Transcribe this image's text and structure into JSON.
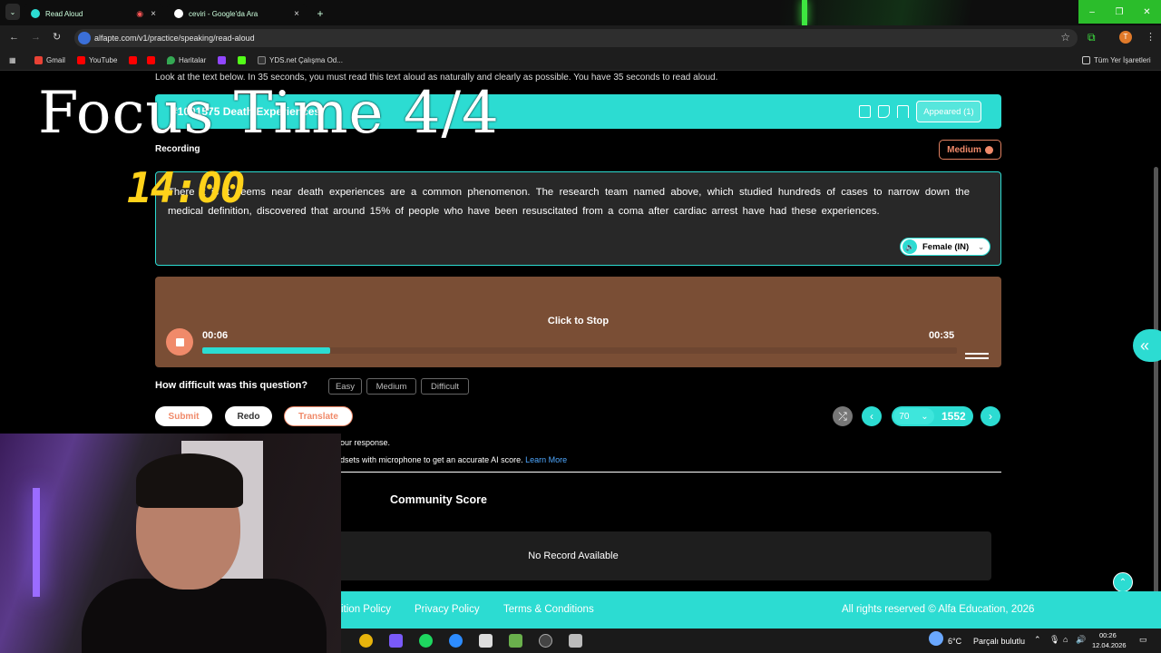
{
  "browser": {
    "tabs": [
      {
        "title": "Read Aloud",
        "active": true
      },
      {
        "title": "ceviri - Google'da Ara",
        "active": false
      }
    ],
    "url": "alfapte.com/v1/practice/speaking/read-aloud",
    "bookmarks": [
      "Gmail",
      "YouTube",
      "Haritalar",
      "YDS.net Çalışma Od..."
    ],
    "bookmarks_all": "Tüm Yer İşaretleri",
    "profile_initial": "T"
  },
  "page": {
    "instruction": "Look at the text below. In 35 seconds, you must read this text aloud as naturally and clearly as possible. You have 35 seconds to read aloud.",
    "question_title": "#1001575 Death Experiences",
    "appeared": "Appeared (1)",
    "status": "Recording",
    "difficulty_badge": "Medium",
    "passage": "There it is it seems near death experiences are a common phenomenon. The research team named above, which studied hundreds of cases to narrow down the medical definition, discovered that around 15% of people who have been resuscitated from a coma after cardiac arrest have had these experiences.",
    "voice": "Female (IN)",
    "recorder": {
      "prompt": "Click to Stop",
      "elapsed": "00:06",
      "total": "00:35",
      "progress": 0.17
    },
    "difficulty_question": "How difficult was this question?",
    "difficulty_options": [
      "Easy",
      "Medium",
      "Difficult"
    ],
    "actions": {
      "submit": "Submit",
      "redo": "Redo",
      "translate": "Translate"
    },
    "pagination": {
      "per_page": "70",
      "total": "1552"
    },
    "tip_1": "our response.",
    "tip_2": "dsets with microphone to get an accurate AI score.",
    "learn_more": "Learn More",
    "community_title": "Community Score",
    "no_record": "No Record Available",
    "footer": {
      "refund": "ition Policy",
      "privacy": "Privacy Policy",
      "terms": "Terms & Conditions",
      "copyright": "All rights reserved © Alfa Education, 2026"
    }
  },
  "overlay": {
    "focus_text": "Focus Time 4/4",
    "timer": "14:00"
  },
  "taskbar": {
    "weather_temp": "6°C",
    "weather_desc": "Parçalı bulutlu",
    "time": "00:26",
    "date": "12.04.2026"
  },
  "colors": {
    "accent": "#2cdcd2",
    "recorder_bg": "#7a4e35",
    "badge": "#f08a6a"
  }
}
